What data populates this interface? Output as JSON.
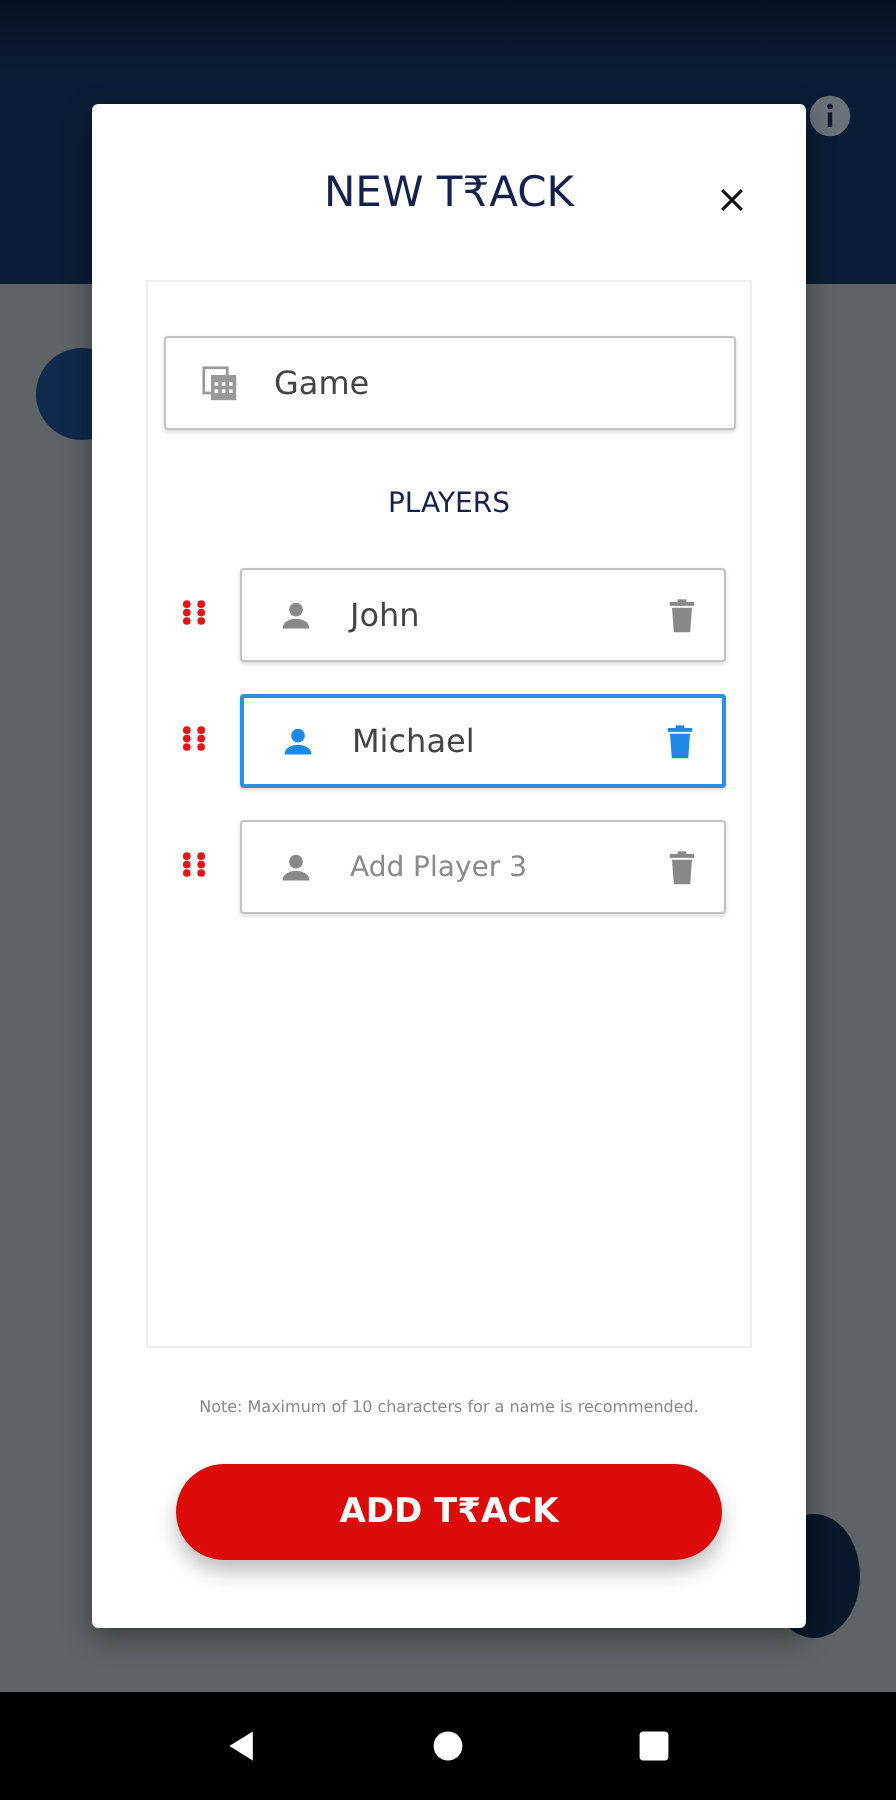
{
  "dialog": {
    "title": "NEW T₹ACK",
    "game_field": {
      "value": "Game"
    },
    "section_title": "PLAYERS",
    "players": [
      {
        "value": "John",
        "selected": false
      },
      {
        "value": "Michael",
        "selected": true
      },
      {
        "placeholder": "Add Player 3",
        "selected": false
      }
    ],
    "note": "Note: Maximum of 10 characters for a name is recommended.",
    "button": "ADD T₹ACK"
  }
}
